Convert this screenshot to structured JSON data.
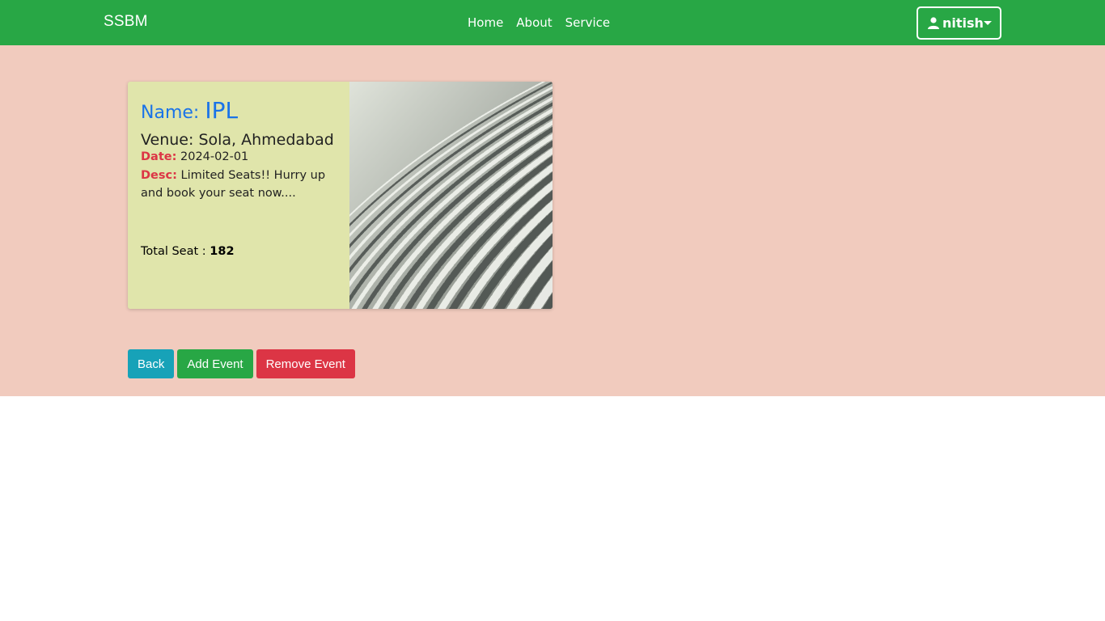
{
  "navbar": {
    "brand": "SSBM",
    "links": [
      "Home",
      "About",
      "Service"
    ],
    "user": "nitish"
  },
  "event": {
    "name_label": "Name:",
    "name": "IPL",
    "venue_label": "Venue:",
    "venue": "Sola, Ahmedabad",
    "date_label": "Date:",
    "date": "2024-02-01",
    "desc_label": "Desc:",
    "desc": "Limited Seats!! Hurry up and book your seat now....",
    "seat_label": "Total Seat :",
    "total_seat": "182"
  },
  "actions": {
    "back": "Back",
    "add": "Add Event",
    "remove": "Remove Event"
  },
  "colors": {
    "navbar": "#28a745",
    "page_bg": "#f1cbbe",
    "card_bg": "#e0e5ab",
    "name_blue": "#1a73e8",
    "label_red": "#dc3545"
  }
}
